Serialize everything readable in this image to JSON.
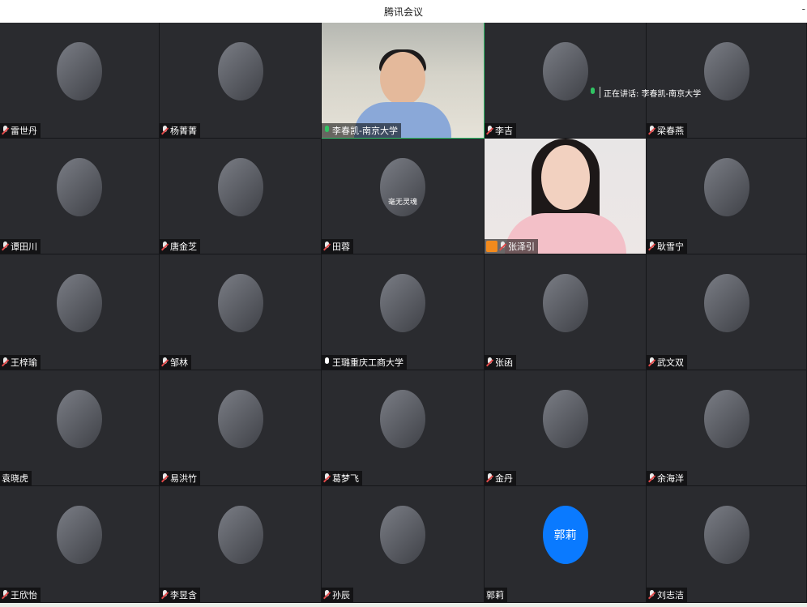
{
  "window": {
    "title": "腾讯会议",
    "minimize_glyph": "-"
  },
  "speaking": {
    "label": "正在讲话: 李春凯-南京大学"
  },
  "participants": [
    {
      "name": "雷世丹",
      "mic": "muted",
      "type": "avatar"
    },
    {
      "name": "杨菁菁",
      "mic": "muted",
      "type": "avatar"
    },
    {
      "name": "李春凯-南京大学",
      "mic": "on",
      "type": "video1",
      "speaking": true
    },
    {
      "name": "李吉",
      "mic": "muted",
      "type": "avatar"
    },
    {
      "name": "梁春燕",
      "mic": "muted",
      "type": "avatar"
    },
    {
      "name": "谭田川",
      "mic": "muted",
      "type": "avatar"
    },
    {
      "name": "唐金芝",
      "mic": "muted",
      "type": "avatar"
    },
    {
      "name": "田蓉",
      "mic": "muted",
      "type": "avatar",
      "avatar_caption": "毫无灵魂"
    },
    {
      "name": "张泽引",
      "mic": "muted",
      "type": "video2",
      "host": true
    },
    {
      "name": "耿雪宁",
      "mic": "muted",
      "type": "avatar"
    },
    {
      "name": "王梓瑜",
      "mic": "muted",
      "type": "avatar"
    },
    {
      "name": "邹林",
      "mic": "muted",
      "type": "avatar"
    },
    {
      "name": "王璐重庆工商大学",
      "mic": "on-white",
      "type": "avatar"
    },
    {
      "name": "张函",
      "mic": "muted",
      "type": "avatar"
    },
    {
      "name": "武文双",
      "mic": "muted",
      "type": "avatar"
    },
    {
      "name": "袁晓虎",
      "mic": "none",
      "type": "avatar"
    },
    {
      "name": "易洪竹",
      "mic": "muted",
      "type": "avatar"
    },
    {
      "name": "葛梦飞",
      "mic": "muted",
      "type": "avatar"
    },
    {
      "name": "金丹",
      "mic": "muted",
      "type": "avatar"
    },
    {
      "name": "余海洋",
      "mic": "muted",
      "type": "avatar"
    },
    {
      "name": "王欣怡",
      "mic": "muted",
      "type": "avatar"
    },
    {
      "name": "李昱含",
      "mic": "muted",
      "type": "avatar"
    },
    {
      "name": "孙辰",
      "mic": "muted",
      "type": "avatar"
    },
    {
      "name": "郭莉",
      "mic": "none",
      "type": "initial",
      "initial_text": "郭莉"
    },
    {
      "name": "刘志洁",
      "mic": "muted",
      "type": "avatar"
    }
  ],
  "colors": {
    "speaking_outline": "#2fc26a",
    "initial_avatar_bg": "#0a7aff",
    "host_badge": "#f28a1d"
  }
}
